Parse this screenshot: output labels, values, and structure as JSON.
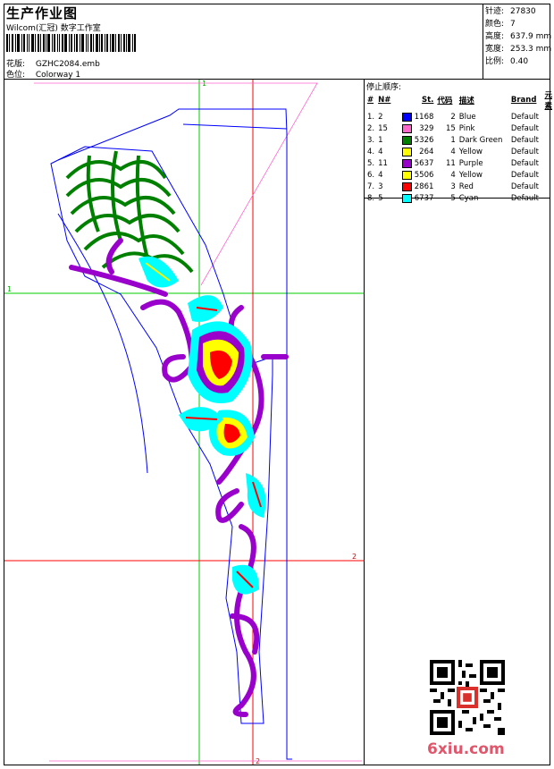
{
  "header": {
    "title": "生产作业图",
    "studio": "Wilcom(汇冠) 数字工作室",
    "design_label": "花版:",
    "design_value": "GZHC2084.emb",
    "colorway_label": "色位:",
    "colorway_value": "Colorway 1"
  },
  "stats": {
    "stitches_label": "针迹:",
    "stitches": "27830",
    "colors_label": "颜色:",
    "colors": "7",
    "height_label": "高度:",
    "height": "637.9 mm",
    "width_label": "宽度:",
    "width": "253.3 mm",
    "scale_label": "比例:",
    "scale": "0.40"
  },
  "stop_sequence": {
    "title": "停止顺序:",
    "columns": [
      "#",
      "N#",
      "St.",
      "代码",
      "描述",
      "Brand",
      "元素"
    ],
    "rows": [
      {
        "idx": "1.",
        "n": "2",
        "color": "#0000ff",
        "st": "1168",
        "code": "2",
        "desc": "Blue",
        "brand": "Default"
      },
      {
        "idx": "2.",
        "n": "15",
        "color": "#ff66cc",
        "st": "329",
        "code": "15",
        "desc": "Pink",
        "brand": "Default"
      },
      {
        "idx": "3.",
        "n": "1",
        "color": "#008000",
        "st": "5326",
        "code": "1",
        "desc": "Dark Green",
        "brand": "Default"
      },
      {
        "idx": "4.",
        "n": "4",
        "color": "#ffff00",
        "st": "264",
        "code": "4",
        "desc": "Yellow",
        "brand": "Default"
      },
      {
        "idx": "5.",
        "n": "11",
        "color": "#9900cc",
        "st": "5637",
        "code": "11",
        "desc": "Purple",
        "brand": "Default"
      },
      {
        "idx": "6.",
        "n": "4",
        "color": "#ffff00",
        "st": "5506",
        "code": "4",
        "desc": "Yellow",
        "brand": "Default"
      },
      {
        "idx": "7.",
        "n": "3",
        "color": "#ff0000",
        "st": "2861",
        "code": "3",
        "desc": "Red",
        "brand": "Default"
      },
      {
        "idx": "8.",
        "n": "5",
        "color": "#00ffff",
        "st": "6737",
        "code": "5",
        "desc": "Cyan",
        "brand": "Default"
      }
    ]
  },
  "guides": {
    "v1": "1",
    "h1": "1",
    "h2": "2",
    "v2": "2"
  },
  "watermark": "6xiu.com"
}
